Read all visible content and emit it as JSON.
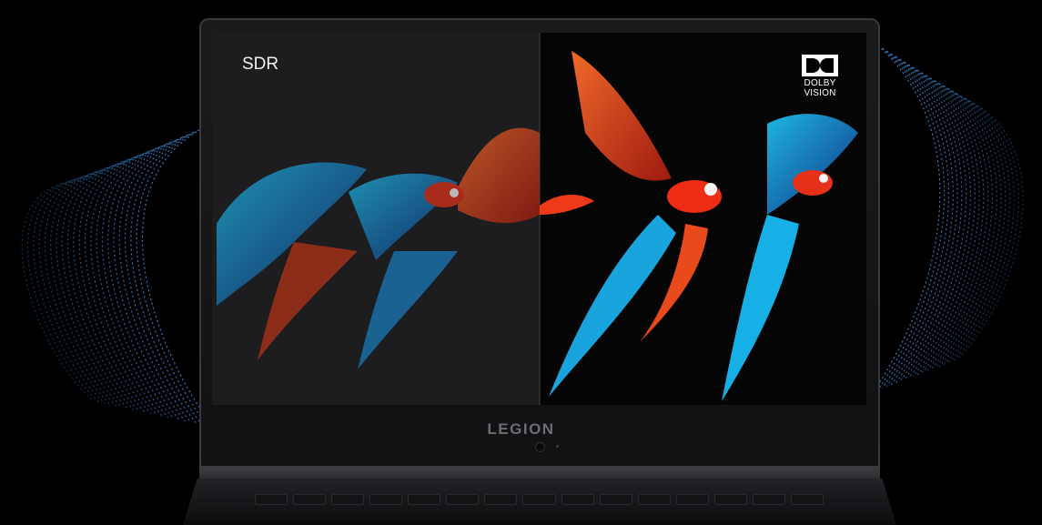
{
  "screen": {
    "left_label": "SDR",
    "right_logo_line1": "DOLBY",
    "right_logo_line2": "VISION"
  },
  "bezel": {
    "brand": "LEGION"
  },
  "icons": [
    "dolby-vision-logo",
    "webcam-icon"
  ]
}
